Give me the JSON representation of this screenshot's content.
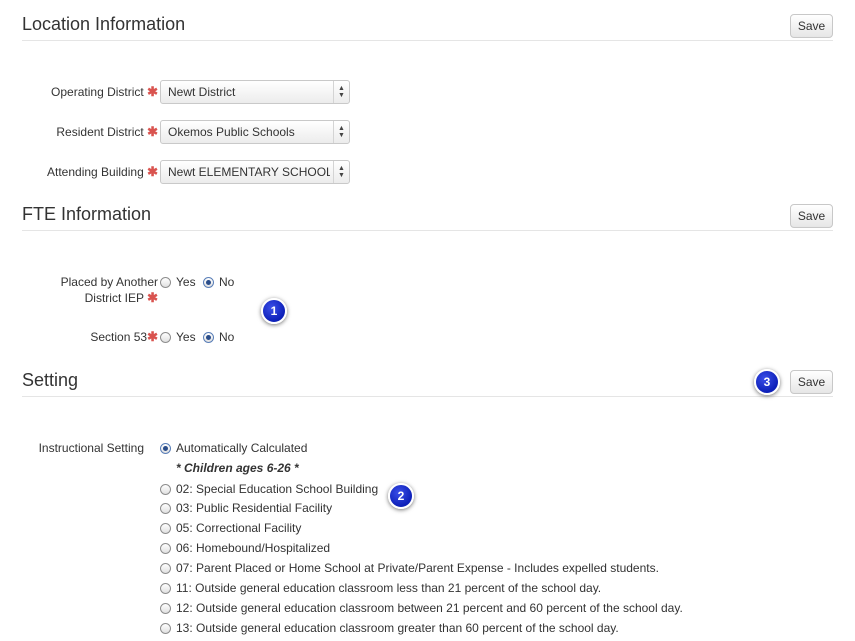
{
  "location": {
    "title": "Location Information",
    "save_label": "Save",
    "fields": [
      {
        "label": "Operating District",
        "value": "Newt District"
      },
      {
        "label": "Resident District",
        "value": "Okemos Public Schools"
      },
      {
        "label": "Attending Building",
        "value": "Newt ELEMENTARY SCHOOLS"
      }
    ]
  },
  "fte": {
    "title": "FTE Information",
    "save_label": "Save",
    "placed_label_line1": "Placed by Another",
    "placed_label_line2": "District IEP",
    "section53_label": "Section 53",
    "yes_label": "Yes",
    "no_label": "No",
    "placed_selected": "No",
    "section53_selected": "No"
  },
  "setting": {
    "title": "Setting",
    "save_label": "Save",
    "instructional_label": "Instructional Setting",
    "subheading": "* Children ages 6-26 *",
    "selected": "Automatically Calculated",
    "options": [
      "Automatically Calculated",
      "02: Special Education School Building",
      "03: Public Residential Facility",
      "05: Correctional Facility",
      "06: Homebound/Hospitalized",
      "07: Parent Placed or Home School at Private/Parent Expense - Includes expelled students.",
      "11: Outside general education classroom less than 21 percent of the school day.",
      "12: Outside general education classroom between 21 percent and 60 percent of the school day.",
      "13: Outside general education classroom greater than 60 percent of the school day."
    ]
  },
  "required_marker": "✱",
  "select_arrow_icon": "up-down-arrows",
  "callouts": [
    "1",
    "2",
    "3"
  ],
  "colors": {
    "required": "#d9534f",
    "callout": "#1228c8",
    "radio_dot": "#2a4d8a"
  }
}
